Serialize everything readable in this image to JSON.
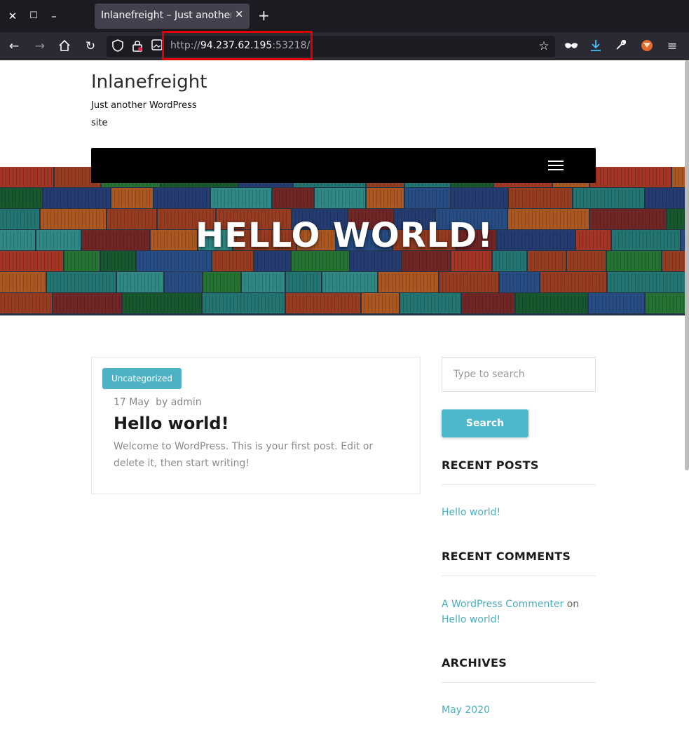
{
  "browser": {
    "tab_title": "Inlanefreight – Just another W",
    "url_scheme": "http://",
    "url_host": "94.237.62.195",
    "url_port": ":53218/",
    "colors": {
      "tabbar": "#1c1b22",
      "toolbar": "#2b2a33",
      "highlight": "#e00000"
    }
  },
  "site": {
    "title": "Inlanefreight",
    "tagline": "Just another WordPress site"
  },
  "hero": {
    "title": "HELLO WORLD!"
  },
  "post": {
    "category": "Uncategorized",
    "date": "17 May",
    "author": "by admin",
    "title": "Hello world!",
    "excerpt": "Welcome to WordPress. This is your first post. Edit or delete it, then start writing!"
  },
  "sidebar": {
    "search_placeholder": "Type to search",
    "search_button": "Search",
    "recent_posts_title": "RECENT POSTS",
    "recent_posts": [
      "Hello world!"
    ],
    "recent_comments_title": "RECENT COMMENTS",
    "comment_author": "A WordPress Commenter",
    "comment_on": "on",
    "comment_post": "Hello world!",
    "archives_title": "ARCHIVES",
    "archives": [
      "May 2020"
    ]
  },
  "theme_colors": {
    "accent": "#4db8cc",
    "nav": "#000000"
  }
}
